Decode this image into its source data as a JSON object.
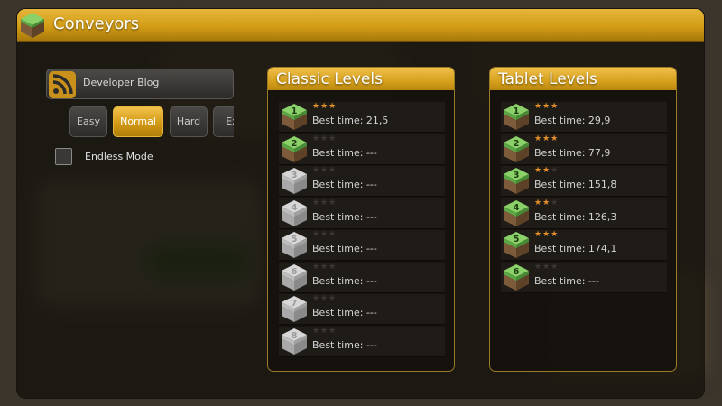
{
  "app": {
    "title": "Conveyors"
  },
  "sidebar": {
    "blog_label": "Developer Blog",
    "difficulties": [
      {
        "label": "Easy",
        "selected": false
      },
      {
        "label": "Normal",
        "selected": true
      },
      {
        "label": "Hard",
        "selected": false
      },
      {
        "label": "Ex",
        "selected": false
      }
    ],
    "endless": {
      "label": "Endless Mode",
      "checked": false
    }
  },
  "classic": {
    "title": "Classic Levels",
    "levels": [
      {
        "number": "1",
        "stars": 3,
        "unlocked": true,
        "best_time": "Best time: 21,5"
      },
      {
        "number": "2",
        "stars": 0,
        "unlocked": true,
        "best_time": "Best time: ---"
      },
      {
        "number": "3",
        "stars": 0,
        "unlocked": false,
        "best_time": "Best time: ---"
      },
      {
        "number": "4",
        "stars": 0,
        "unlocked": false,
        "best_time": "Best time: ---"
      },
      {
        "number": "5",
        "stars": 0,
        "unlocked": false,
        "best_time": "Best time: ---"
      },
      {
        "number": "6",
        "stars": 0,
        "unlocked": false,
        "best_time": "Best time: ---"
      },
      {
        "number": "7",
        "stars": 0,
        "unlocked": false,
        "best_time": "Best time: ---"
      },
      {
        "number": "8",
        "stars": 0,
        "unlocked": false,
        "best_time": "Best time: ---"
      }
    ]
  },
  "tablet": {
    "title": "Tablet Levels",
    "levels": [
      {
        "number": "1",
        "stars": 3,
        "unlocked": true,
        "best_time": "Best time: 29,9"
      },
      {
        "number": "2",
        "stars": 3,
        "unlocked": true,
        "best_time": "Best time: 77,9"
      },
      {
        "number": "3",
        "stars": 2,
        "unlocked": true,
        "best_time": "Best time: 151,8"
      },
      {
        "number": "4",
        "stars": 2,
        "unlocked": true,
        "best_time": "Best time: 126,3"
      },
      {
        "number": "5",
        "stars": 3,
        "unlocked": true,
        "best_time": "Best time: 174,1"
      },
      {
        "number": "6",
        "stars": 0,
        "unlocked": true,
        "best_time": "Best time: ---"
      }
    ]
  },
  "colors": {
    "accent_gold": "#d7a11d",
    "star_on": "#e3902b",
    "cube_green": "#5aa845",
    "cube_gray": "#9a9a9a"
  }
}
